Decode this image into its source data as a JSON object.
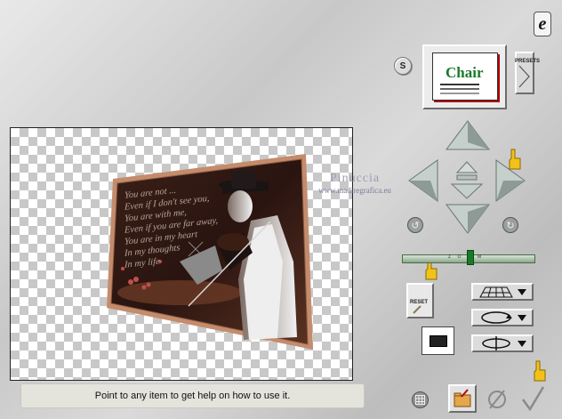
{
  "app": {
    "logo_glyph": "e"
  },
  "preset": {
    "s_button": "S",
    "thumbnail_word": "Chair",
    "presets_label": "PRESETS"
  },
  "preview": {
    "poem_lines": [
      "You are not ...",
      "Even if I don't see you,",
      "You are with me,",
      "Even if you are far away,",
      "You are in my heart",
      "In my thoughts",
      "In my life"
    ],
    "watermark_name": "Pinuccia",
    "watermark_url": "www.madiregrafica.eu"
  },
  "zoom": {
    "label": "Z O O M",
    "level": 0.52
  },
  "reset": {
    "label": "RESET"
  },
  "status": {
    "help_text": "Point to any item to get help on how to use it."
  },
  "icons": {
    "pointer_hand": "pointing-hand-icon",
    "grid": "grid-icon",
    "folder": "folder-icon",
    "cancel": "cancel-icon",
    "ok": "checkmark-icon"
  },
  "colors": {
    "frame": "#c48c6c",
    "accent": "#1a7a2a"
  }
}
